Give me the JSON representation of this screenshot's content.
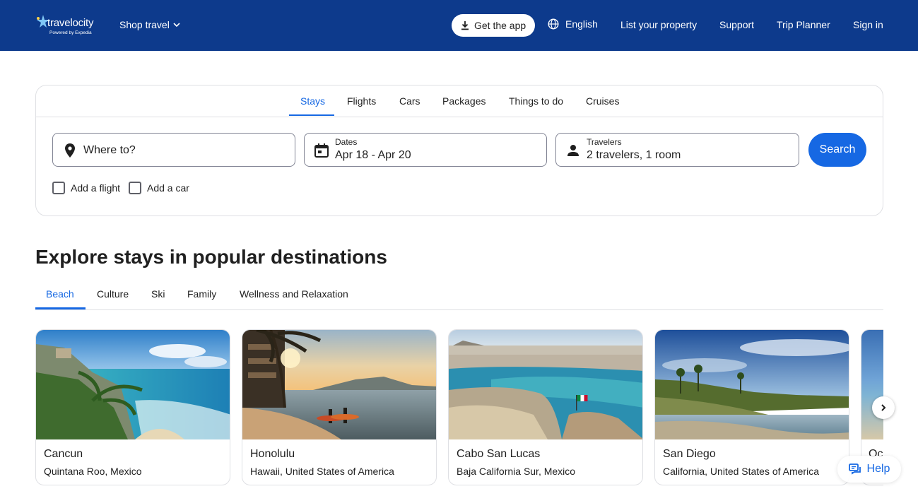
{
  "header": {
    "logo_text": "travelocity",
    "logo_sub": "Powered by Expedia",
    "shop_travel": "Shop travel",
    "get_app": "Get the app",
    "language": "English",
    "list_property": "List your property",
    "support": "Support",
    "trip_planner": "Trip Planner",
    "sign_in": "Sign in"
  },
  "search": {
    "tabs": [
      "Stays",
      "Flights",
      "Cars",
      "Packages",
      "Things to do",
      "Cruises"
    ],
    "active_tab": "Stays",
    "where_placeholder": "Where to?",
    "dates_label": "Dates",
    "dates_value": "Apr 18 - Apr 20",
    "travelers_label": "Travelers",
    "travelers_value": "2 travelers, 1 room",
    "search_button": "Search",
    "add_flight": "Add a flight",
    "add_car": "Add a car"
  },
  "explore": {
    "title": "Explore stays in popular destinations",
    "categories": [
      "Beach",
      "Culture",
      "Ski",
      "Family",
      "Wellness and Relaxation"
    ],
    "active_category": "Beach",
    "cards": [
      {
        "city": "Cancun",
        "region": "Quintana Roo, Mexico"
      },
      {
        "city": "Honolulu",
        "region": "Hawaii, United States of America"
      },
      {
        "city": "Cabo San Lucas",
        "region": "Baja California Sur, Mexico"
      },
      {
        "city": "San Diego",
        "region": "California, United States of America"
      }
    ],
    "partial_card_text": "Oc"
  },
  "help": "Help",
  "colors": {
    "header_bg": "#0d3a8c",
    "accent": "#1668e3"
  },
  "icons": [
    "star-logo-icon",
    "chevron-down-icon",
    "download-icon",
    "globe-icon",
    "map-pin-icon",
    "calendar-icon",
    "person-icon",
    "chevron-right-icon",
    "chat-icon"
  ]
}
